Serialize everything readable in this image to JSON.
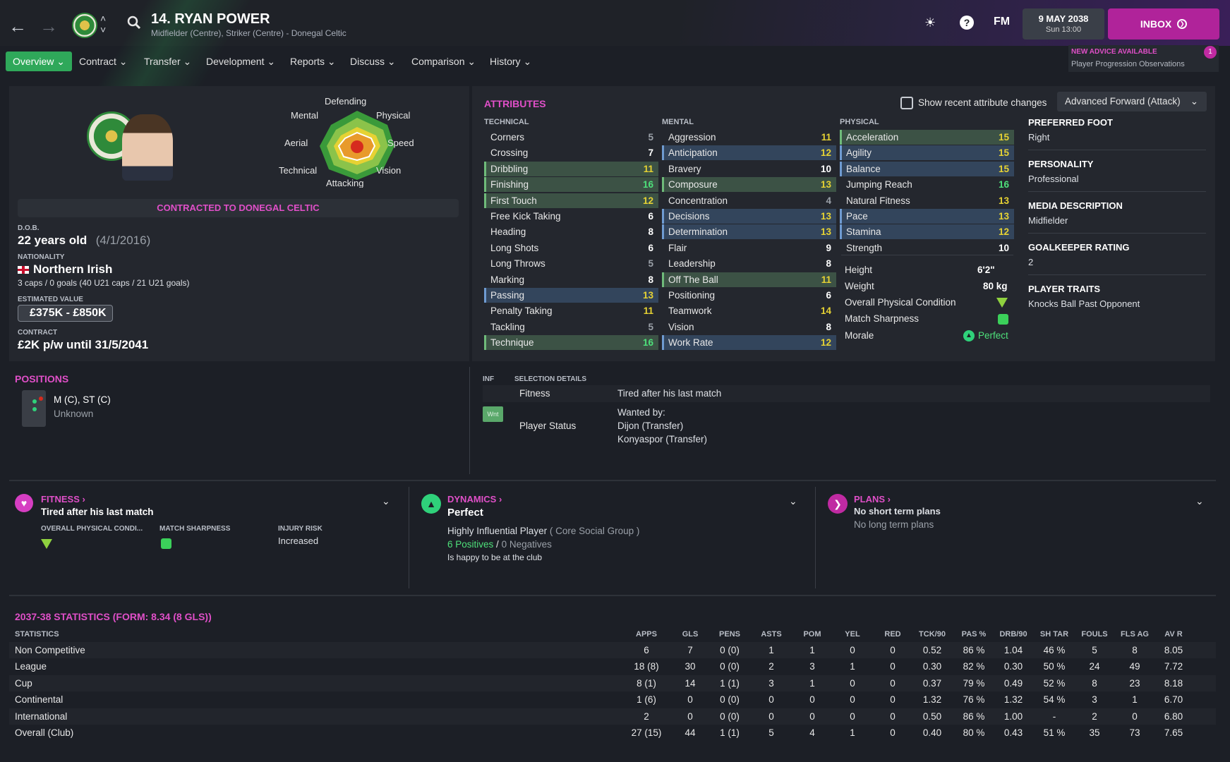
{
  "header": {
    "player_name": "14. RYAN POWER",
    "subtitle": "Midfielder (Centre), Striker (Centre) - Donegal Celtic",
    "fm_label": "FM",
    "date": "9 MAY 2038",
    "time": "Sun 13:00",
    "inbox_label": "INBOX"
  },
  "menu": [
    "Overview",
    "Contract",
    "Transfer",
    "Development",
    "Reports",
    "Discuss",
    "Comparison",
    "History"
  ],
  "advice": {
    "title": "NEW ADVICE AVAILABLE",
    "text": "Player Progression Observations",
    "count": "1"
  },
  "profile": {
    "radar_labels": {
      "top": "Defending",
      "top_left": "Mental",
      "top_right": "Physical",
      "left": "Aerial",
      "right": "Speed",
      "bottom_left": "Technical",
      "bottom_right": "Vision",
      "bottom": "Attacking"
    },
    "contract_banner": "CONTRACTED TO DONEGAL CELTIC",
    "dob_label": "D.O.B.",
    "age": "22 years old",
    "dob": "(4/1/2016)",
    "nationality_label": "NATIONALITY",
    "nationality": "Northern Irish",
    "caps": "3 caps / 0 goals (40 U21 caps / 21 U21 goals)",
    "value_label": "ESTIMATED VALUE",
    "value": "£375K - £850K",
    "contract_label": "CONTRACT",
    "contract": "£2K p/w until 31/5/2041"
  },
  "attributes": {
    "title": "ATTRIBUTES",
    "show_changes": "Show recent attribute changes",
    "role": "Advanced Forward (Attack)",
    "technical_label": "TECHNICAL",
    "mental_label": "MENTAL",
    "physical_label": "PHYSICAL",
    "technical": [
      [
        "Corners",
        "5"
      ],
      [
        "Crossing",
        "7"
      ],
      [
        "Dribbling",
        "11"
      ],
      [
        "Finishing",
        "16"
      ],
      [
        "First Touch",
        "12"
      ],
      [
        "Free Kick Taking",
        "6"
      ],
      [
        "Heading",
        "8"
      ],
      [
        "Long Shots",
        "6"
      ],
      [
        "Long Throws",
        "5"
      ],
      [
        "Marking",
        "8"
      ],
      [
        "Passing",
        "13"
      ],
      [
        "Penalty Taking",
        "11"
      ],
      [
        "Tackling",
        "5"
      ],
      [
        "Technique",
        "16"
      ]
    ],
    "mental": [
      [
        "Aggression",
        "11"
      ],
      [
        "Anticipation",
        "12"
      ],
      [
        "Bravery",
        "10"
      ],
      [
        "Composure",
        "13"
      ],
      [
        "Concentration",
        "4"
      ],
      [
        "Decisions",
        "13"
      ],
      [
        "Determination",
        "13"
      ],
      [
        "Flair",
        "9"
      ],
      [
        "Leadership",
        "8"
      ],
      [
        "Off The Ball",
        "11"
      ],
      [
        "Positioning",
        "6"
      ],
      [
        "Teamwork",
        "14"
      ],
      [
        "Vision",
        "8"
      ],
      [
        "Work Rate",
        "12"
      ]
    ],
    "physical": [
      [
        "Acceleration",
        "15"
      ],
      [
        "Agility",
        "15"
      ],
      [
        "Balance",
        "15"
      ],
      [
        "Jumping Reach",
        "16"
      ],
      [
        "Natural Fitness",
        "13"
      ],
      [
        "Pace",
        "13"
      ],
      [
        "Stamina",
        "12"
      ],
      [
        "Strength",
        "10"
      ]
    ],
    "height_label": "Height",
    "height": "6'2\"",
    "weight_label": "Weight",
    "weight": "80 kg",
    "opc_label": "Overall Physical Condition",
    "sharp_label": "Match Sharpness",
    "morale_label": "Morale",
    "morale": "Perfect"
  },
  "side": {
    "foot_label": "PREFERRED FOOT",
    "foot": "Right",
    "pers_label": "PERSONALITY",
    "pers": "Professional",
    "media_label": "MEDIA DESCRIPTION",
    "media": "Midfielder",
    "gk_label": "GOALKEEPER RATING",
    "gk": "2",
    "traits_label": "PLAYER TRAITS",
    "traits": "Knocks Ball Past Opponent"
  },
  "positions": {
    "title": "POSITIONS",
    "pos": "M (C), ST (C)",
    "sub": "Unknown"
  },
  "selection": {
    "inf": "INF",
    "title": "SELECTION DETAILS",
    "fitness_label": "Fitness",
    "fitness": "Tired after his last match",
    "badge": "Wnt",
    "status_label": "Player Status",
    "wanted": "Wanted by:",
    "club1": "Dijon (Transfer)",
    "club2": "Konyaspor (Transfer)"
  },
  "fitness": {
    "title": "FITNESS",
    "headline": "Tired after his last match",
    "opc": "OVERALL PHYSICAL CONDI...",
    "sharp": "MATCH SHARPNESS",
    "injury_label": "INJURY RISK",
    "injury": "Increased"
  },
  "dynamics": {
    "title": "DYNAMICS",
    "headline": "Perfect",
    "influence": "Highly Influential Player",
    "group": "( Core Social Group )",
    "positives": "6 Positives",
    "sep": "/",
    "negatives": "0 Negatives",
    "happy": "Is happy to be at the club"
  },
  "plans": {
    "title": "PLANS",
    "short": "No short term plans",
    "long": "No long term plans"
  },
  "stats": {
    "title": "2037-38 STATISTICS (FORM: 8.34 (8 GLS))",
    "columns": [
      "STATISTICS",
      "APPS",
      "GLS",
      "PENS",
      "ASTS",
      "POM",
      "YEL",
      "RED",
      "TCK/90",
      "PAS %",
      "DRB/90",
      "SH TAR",
      "FOULS",
      "FLS AG",
      "AV R"
    ],
    "rows": [
      [
        "Non Competitive",
        "6",
        "7",
        "0 (0)",
        "1",
        "1",
        "0",
        "0",
        "0.52",
        "86 %",
        "1.04",
        "46 %",
        "5",
        "8",
        "8.05"
      ],
      [
        "League",
        "18 (8)",
        "30",
        "0 (0)",
        "2",
        "3",
        "1",
        "0",
        "0.30",
        "82 %",
        "0.30",
        "50 %",
        "24",
        "49",
        "7.72"
      ],
      [
        "Cup",
        "8 (1)",
        "14",
        "1 (1)",
        "3",
        "1",
        "0",
        "0",
        "0.37",
        "79 %",
        "0.49",
        "52 %",
        "8",
        "23",
        "8.18"
      ],
      [
        "Continental",
        "1 (6)",
        "0",
        "0 (0)",
        "0",
        "0",
        "0",
        "0",
        "1.32",
        "76 %",
        "1.32",
        "54 %",
        "3",
        "1",
        "6.70"
      ],
      [
        "International",
        "2",
        "0",
        "0 (0)",
        "0",
        "0",
        "0",
        "0",
        "0.50",
        "86 %",
        "1.00",
        "-",
        "2",
        "0",
        "6.80"
      ],
      [
        "Overall (Club)",
        "27 (15)",
        "44",
        "1 (1)",
        "5",
        "4",
        "1",
        "0",
        "0.40",
        "80 %",
        "0.43",
        "51 %",
        "35",
        "73",
        "7.65"
      ]
    ]
  }
}
